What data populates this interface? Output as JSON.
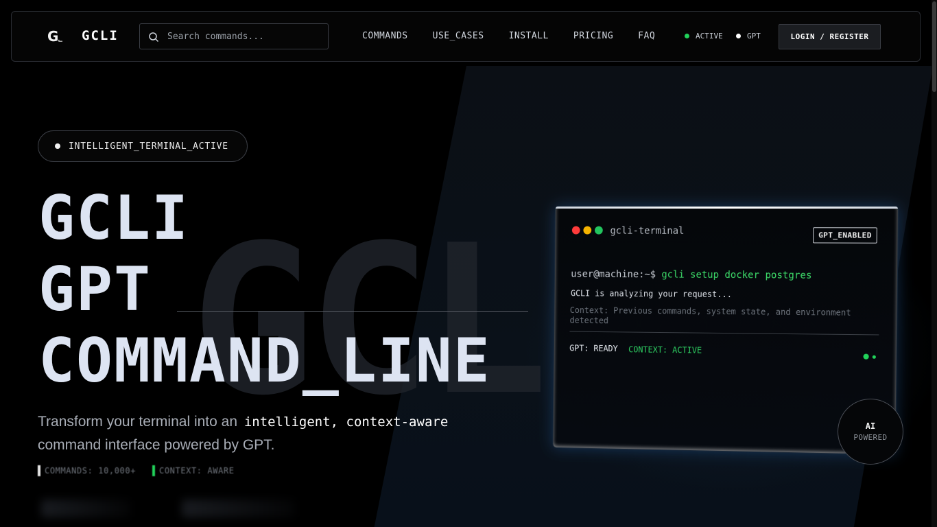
{
  "nav": {
    "logo_mark": "G",
    "logo_sub": "⌙",
    "brand": "GCLI",
    "search_placeholder": "Search commands...",
    "links": [
      "COMMANDS",
      "USE_CASES",
      "INSTALL",
      "PRICING",
      "FAQ"
    ],
    "status_active": "ACTIVE",
    "status_gpt": "GPT",
    "login_label": "LOGIN / REGISTER"
  },
  "hero": {
    "badge": "INTELLIGENT_TERMINAL_ACTIVE",
    "watermark": "GCLI",
    "line1": "GCLI",
    "line2": "GPT",
    "line3": "COMMAND_LINE",
    "tagline_pre": "Transform your terminal into an",
    "tagline_hl": "intelligent, context-aware",
    "tagline_post": "command interface powered by GPT.",
    "stat_commands": "COMMANDS: 10,000+",
    "stat_context": "CONTEXT: AWARE"
  },
  "terminal": {
    "title": "gcli-terminal",
    "tag": "GPT_ENABLED",
    "prompt": "user@machine:~$",
    "command": "gcli setup docker postgres",
    "analyzing": "GCLI is analyzing your request...",
    "context_note": "Context: Previous commands, system state, and environment detected",
    "gpt_status": "GPT: READY",
    "context_status": "CONTEXT: ACTIVE"
  },
  "ai_badge": {
    "line1": "AI",
    "line2": "POWERED"
  },
  "colors": {
    "accent_green": "#21d25a",
    "light_red": "#ff3b3b",
    "light_yellow": "#f5b300",
    "light_green": "#22c55e",
    "background": "#000000"
  }
}
